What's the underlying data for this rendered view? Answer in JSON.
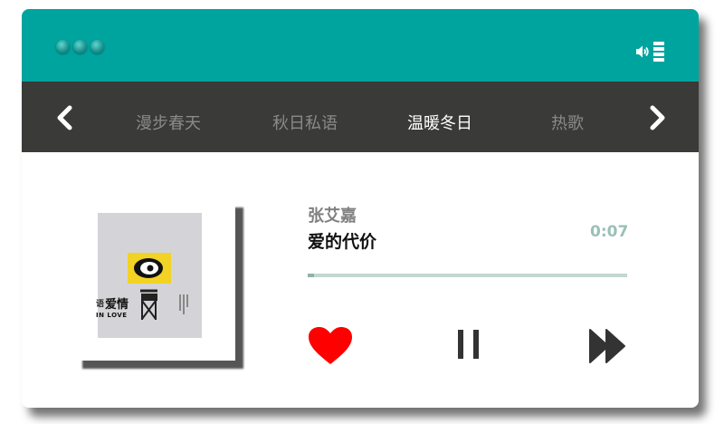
{
  "colors": {
    "accent": "#00a49f",
    "nav_background": "#3a3a38",
    "heart": "#ff0000",
    "time": "#9bbfb8",
    "progress_track": "#c3d6d2"
  },
  "window": {
    "window_buttons": [
      "dot-1",
      "dot-2",
      "dot-3"
    ],
    "volume_icon": "speaker-icon",
    "volume_level_icon": "volume-bars-icon"
  },
  "nav": {
    "prev_icon": "chevron-left-icon",
    "next_icon": "chevron-right-icon",
    "tabs": [
      {
        "label": "漫步春天",
        "active": false
      },
      {
        "label": "秋日私语",
        "active": false
      },
      {
        "label": "温暖冬日",
        "active": true
      },
      {
        "label": "热歌",
        "active": false
      }
    ]
  },
  "track": {
    "artist": "张艾嘉",
    "title": "爱的代价",
    "elapsed": "0:07",
    "progress_fraction": 0.02
  },
  "album_art": {
    "text_main": "爱情",
    "text_prefix": "语",
    "text_en": "IN LOVE"
  },
  "controls": {
    "like_icon": "heart-icon",
    "pause_icon": "pause-icon",
    "forward_icon": "fast-forward-icon"
  }
}
